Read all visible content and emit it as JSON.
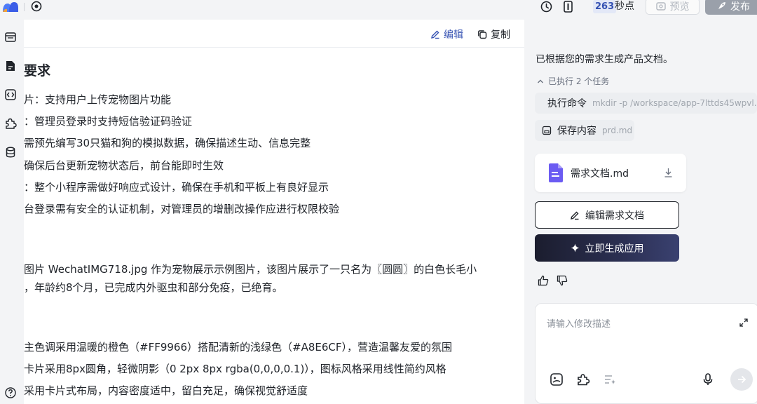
{
  "topbar": {
    "timer_value": "263",
    "timer_unit": "秒点",
    "preview_label": "预览",
    "publish_label": "发布"
  },
  "editor": {
    "edit_label": "编辑",
    "copy_label": "复制",
    "heading": "要求",
    "lines": [
      "片：支持用户上传宠物图片功能",
      "：管理员登录时支持短信验证码验证",
      "需预先编写30只猫和狗的模拟数据，确保描述生动、信息完整",
      "确保后台更新宠物状态后，前台能即时生效",
      "：整个小程序需做好响应式设计，确保在手机和平板上有良好显示",
      "台登录需有安全的认证机制，对管理员的增删改操作应进行权限校验",
      "图片 WechatIMG718.jpg 作为宠物展示示例图片，该图片展示了一只名为〖圆圆〗的白色长毛小",
      "，年龄约8个月，已完成内外驱虫和部分免疫，已绝育。",
      "主色调采用温暖的橙色（#FF9966）搭配清新的浅绿色（#A8E6CF），营造温馨友爱的氛围",
      "卡片采用8px圆角，轻微阴影（0 2px 8px rgba(0,0,0,0.1)），图标风格采用线性简约风格",
      "采用卡片式布局，内容密度适中，留白充足，确保视觉舒适度"
    ]
  },
  "chat": {
    "message": "已根据您的需求生成产品文档。",
    "tasks_summary": "已执行 2 个任务",
    "tasks": [
      {
        "label": "执行命令",
        "arg": "mkdir -p /workspace/app-7lttds45wpvl..."
      },
      {
        "label": "保存内容",
        "arg": "prd.md"
      }
    ],
    "file_name": "需求文档.md",
    "edit_doc_label": "编辑需求文档",
    "generate_app_label": "立即生成应用",
    "input_placeholder": "请输入修改描述"
  }
}
